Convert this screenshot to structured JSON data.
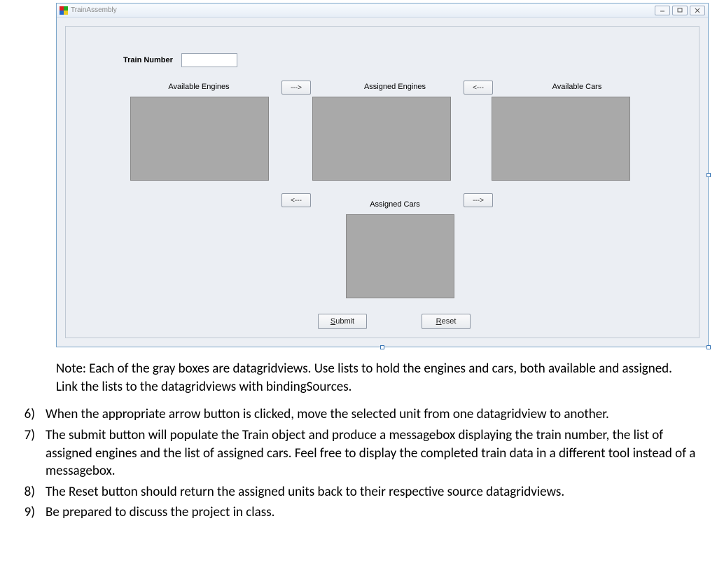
{
  "window": {
    "title": "TrainAssembly",
    "controls": {
      "minimize": "—",
      "maximize": "□",
      "close": "✕"
    }
  },
  "form": {
    "train_number_label": "Train Number",
    "train_number_value": "",
    "captions": {
      "available_engines": "Available Engines",
      "assigned_engines": "Assigned Engines",
      "available_cars": "Available Cars",
      "assigned_cars": "Assigned Cars"
    },
    "arrows": {
      "right": "--->",
      "left": "<---"
    },
    "buttons": {
      "submit": "Submit",
      "reset": "Reset"
    }
  },
  "document": {
    "note": "Note: Each of the gray boxes are datagridviews.  Use lists to hold the engines and cars, both available and assigned. Link the lists to the datagridviews with bindingSources.",
    "items": [
      {
        "num": "6)",
        "text": "When the appropriate arrow button is clicked, move the selected unit from one datagridview to another."
      },
      {
        "num": "7)",
        "text": "The submit button will populate the Train object and produce a messagebox displaying the train number, the list of assigned engines and the list of assigned cars. Feel free to display the completed train data in a different tool instead of a messagebox."
      },
      {
        "num": "8)",
        "text": "The Reset button should return the assigned units back to their respective source datagridviews."
      },
      {
        "num": "9)",
        "text": "Be prepared to discuss the project in class."
      }
    ]
  }
}
